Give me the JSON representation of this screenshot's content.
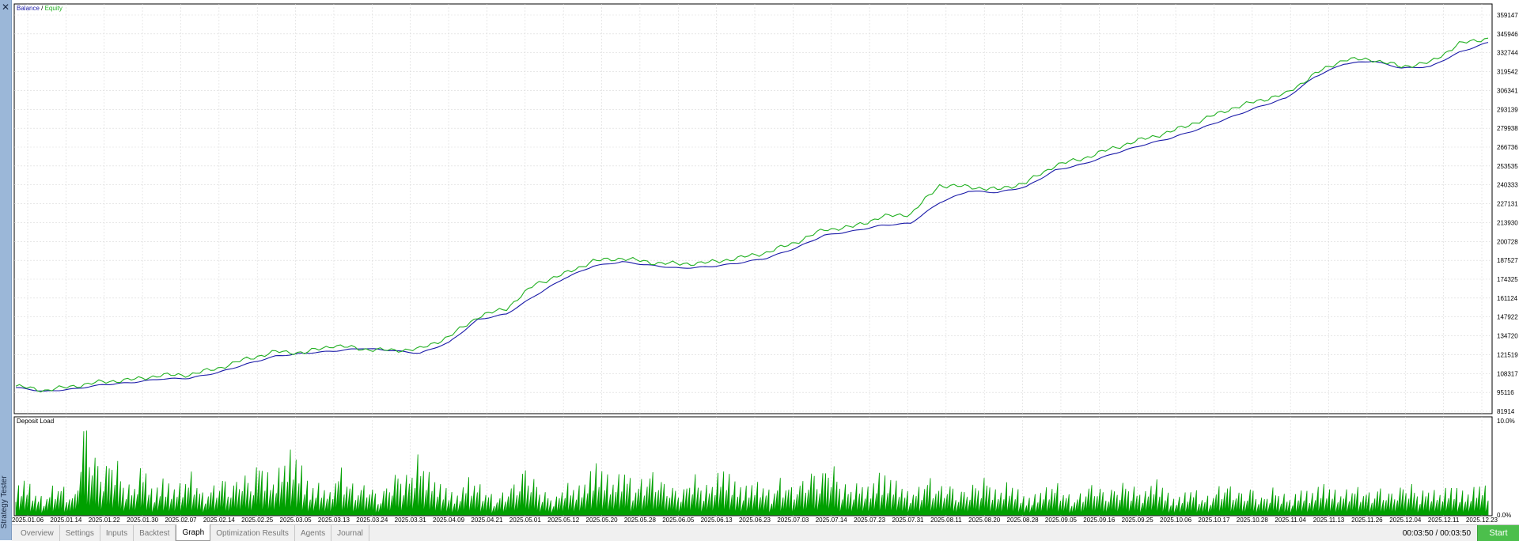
{
  "window": {
    "side_title": "Strategy Tester",
    "close_symbol": "✕"
  },
  "colors": {
    "balance": "#1a1aa8",
    "equity": "#22b022",
    "deposit_load": "#00a000",
    "grid": "#d9d9d9"
  },
  "chart_data": [
    {
      "type": "line",
      "title_parts": [
        "Balance",
        " / ",
        "Equity"
      ],
      "x": [
        "2025.01.06",
        "2025.01.14",
        "2025.01.22",
        "2025.01.30",
        "2025.02.07",
        "2025.02.14",
        "2025.02.25",
        "2025.03.05",
        "2025.03.13",
        "2025.03.24",
        "2025.03.31",
        "2025.04.09",
        "2025.04.21",
        "2025.05.01",
        "2025.05.12",
        "2025.05.20",
        "2025.05.28",
        "2025.06.05",
        "2025.06.13",
        "2025.06.23",
        "2025.07.03",
        "2025.07.14",
        "2025.07.23",
        "2025.07.31",
        "2025.08.11",
        "2025.08.20",
        "2025.08.28",
        "2025.09.05",
        "2025.09.16",
        "2025.09.25",
        "2025.10.06",
        "2025.10.17",
        "2025.10.28",
        "2025.11.04",
        "2025.11.13",
        "2025.11.26",
        "2025.12.04",
        "2025.12.11",
        "2025.12.23"
      ],
      "y_ticks": [
        "359147",
        "345946",
        "332744",
        "319542",
        "306341",
        "293139",
        "279938",
        "266736",
        "253535",
        "240333",
        "227131",
        "213930",
        "200728",
        "187527",
        "174325",
        "161124",
        "147922",
        "134720",
        "121519",
        "108317",
        "95116",
        "81914"
      ],
      "ylim": [
        81914,
        359147
      ],
      "grid": true,
      "series": [
        {
          "name": "Balance",
          "values": [
            98500,
            95800,
            97500,
            100500,
            102000,
            104500,
            105000,
            109000,
            115000,
            120500,
            122500,
            124000,
            126000,
            124500,
            122500,
            130000,
            146000,
            150000,
            163000,
            175000,
            183500,
            186500,
            184000,
            182000,
            183000,
            185500,
            189000,
            196000,
            205000,
            208000,
            212000,
            213500,
            228000,
            236000,
            235000,
            239000,
            250500,
            255000,
            262000,
            268000,
            273000,
            279500,
            287000,
            294500,
            301000,
            316000,
            325000,
            327000,
            322000,
            323000,
            333000,
            340000
          ]
        },
        {
          "name": "Equity",
          "values": [
            99500,
            96500,
            99500,
            102500,
            104000,
            107000,
            107500,
            112000,
            118500,
            123500,
            123000,
            128000,
            125500,
            124500,
            125500,
            134000,
            148000,
            154000,
            171000,
            178000,
            187000,
            189000,
            186000,
            185000,
            186000,
            189000,
            193000,
            200000,
            209000,
            211000,
            218000,
            220000,
            240000,
            239000,
            237000,
            242000,
            254000,
            259000,
            266000,
            272000,
            277500,
            285000,
            293000,
            299000,
            304000,
            318000,
            328000,
            328000,
            323000,
            326000,
            339000,
            343000
          ]
        }
      ]
    },
    {
      "type": "area",
      "title": "Deposit Load",
      "y_ticks": [
        "10.0%",
        "0.0%"
      ],
      "ylim": [
        0,
        10
      ],
      "series": [
        {
          "name": "Deposit Load",
          "values": [
            2.5,
            3.5,
            2,
            1.5,
            3,
            2.5,
            1.5,
            8.8,
            5.5,
            4,
            6,
            3,
            2.5,
            5,
            2,
            3.5,
            2.5,
            3,
            4,
            2,
            2.5,
            3.5,
            2.5,
            4,
            3,
            5.5,
            3,
            4.5,
            6,
            5,
            2.5,
            3,
            2,
            4.5,
            3,
            2.5,
            3,
            1.5,
            3,
            4,
            3.5,
            5.5,
            4,
            3,
            2.5,
            1.8,
            3.5,
            3,
            2.2,
            1.5,
            2.4,
            3,
            4.5,
            3,
            2,
            1.5,
            3,
            2.5,
            3,
            5,
            4,
            3,
            4.5,
            2.5,
            3.5,
            4,
            3,
            2.5,
            2.2,
            4,
            2.5,
            3,
            4.5,
            3.5,
            2.5,
            3,
            3,
            2,
            3.5,
            2.5,
            3,
            4,
            3.5,
            5.2,
            3,
            2.5,
            3,
            2.5,
            4,
            3.5,
            3,
            2,
            2.5,
            3.5,
            2.5,
            3,
            2,
            2.5,
            3,
            3.5,
            2,
            3,
            2.5,
            1.5,
            2,
            2.5,
            3,
            2,
            1.5,
            2.5,
            3,
            2,
            2.5,
            3,
            2.5,
            2,
            3.5,
            2.5,
            1.5,
            2,
            2.5,
            1.5,
            2,
            3,
            2.5,
            2,
            2.5,
            1.5,
            2.5,
            2,
            1.5,
            2.5,
            2,
            3,
            2.5,
            2,
            2.5,
            2.5,
            2,
            2.5,
            2,
            2.5,
            3,
            2,
            2.5,
            2,
            2.7,
            2.5,
            2,
            3,
            2.5
          ]
        }
      ]
    }
  ],
  "tabs": [
    "Overview",
    "Settings",
    "Inputs",
    "Backtest",
    "Graph",
    "Optimization Results",
    "Agents",
    "Journal"
  ],
  "active_tab": "Graph",
  "timer": "00:03:50 / 00:03:50",
  "start_label": "Start"
}
